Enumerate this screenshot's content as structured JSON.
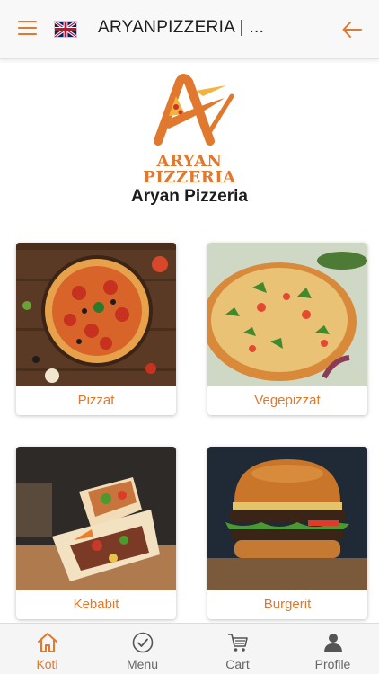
{
  "header": {
    "title": "ARYANPIZZERIA | ...",
    "menu_icon": "hamburger-icon",
    "language_flag": "uk-flag-icon",
    "back_icon": "arrow-left-icon"
  },
  "brand": {
    "logo_line1": "ARYAN",
    "logo_line2": "PIZZERIA",
    "name": "Aryan Pizzeria"
  },
  "categories": [
    {
      "label": "Pizzat"
    },
    {
      "label": "Vegepizzat"
    },
    {
      "label": "Kebabit"
    },
    {
      "label": "Burgerit"
    }
  ],
  "bottom_nav": {
    "items": [
      {
        "label": "Koti",
        "icon": "home-icon",
        "active": true
      },
      {
        "label": "Menu",
        "icon": "check-circle-icon",
        "active": false
      },
      {
        "label": "Cart",
        "icon": "cart-icon",
        "active": false
      },
      {
        "label": "Profile",
        "icon": "person-icon",
        "active": false
      }
    ]
  },
  "colors": {
    "accent": "#e0782e",
    "topbar_bg": "#f8f8f8",
    "nav_bg": "#f5f5f5"
  }
}
